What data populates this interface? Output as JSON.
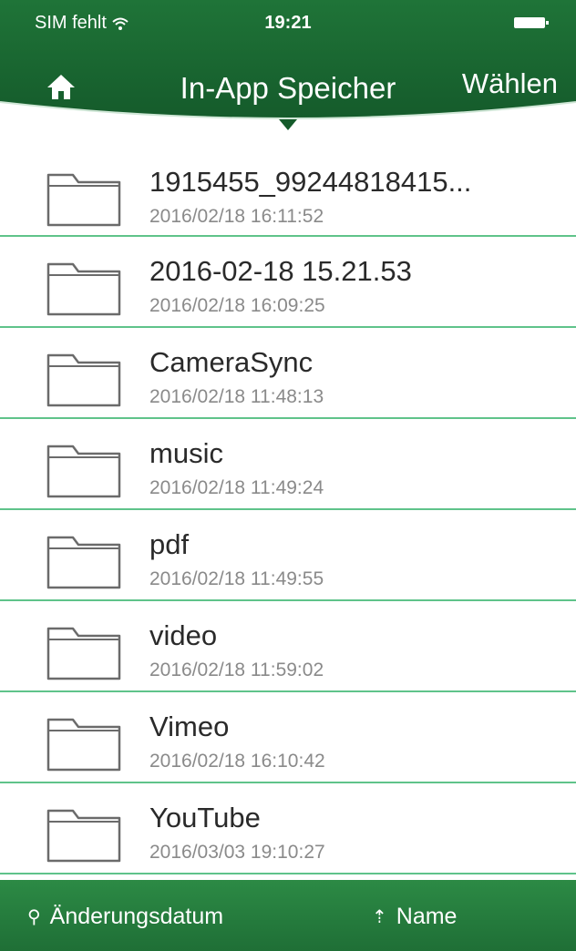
{
  "status_bar": {
    "carrier": "SIM fehlt",
    "time": "19:21"
  },
  "nav": {
    "title": "In-App Speicher",
    "select_label": "Wählen"
  },
  "files": [
    {
      "name": "1915455_99244818415...",
      "date": "2016/02/18 16:11:52"
    },
    {
      "name": "2016-02-18 15.21.53",
      "date": "2016/02/18 16:09:25"
    },
    {
      "name": "CameraSync",
      "date": "2016/02/18 11:48:13"
    },
    {
      "name": "music",
      "date": "2016/02/18 11:49:24"
    },
    {
      "name": "pdf",
      "date": "2016/02/18 11:49:55"
    },
    {
      "name": "video",
      "date": "2016/02/18 11:59:02"
    },
    {
      "name": "Vimeo",
      "date": "2016/02/18 16:10:42"
    },
    {
      "name": "YouTube",
      "date": "2016/03/03 19:10:27"
    }
  ],
  "footer": {
    "sort_date": "Änderungsdatum",
    "sort_name": "Name"
  },
  "colors": {
    "header_green": "#1f6f36",
    "separator": "#5fc38a"
  }
}
